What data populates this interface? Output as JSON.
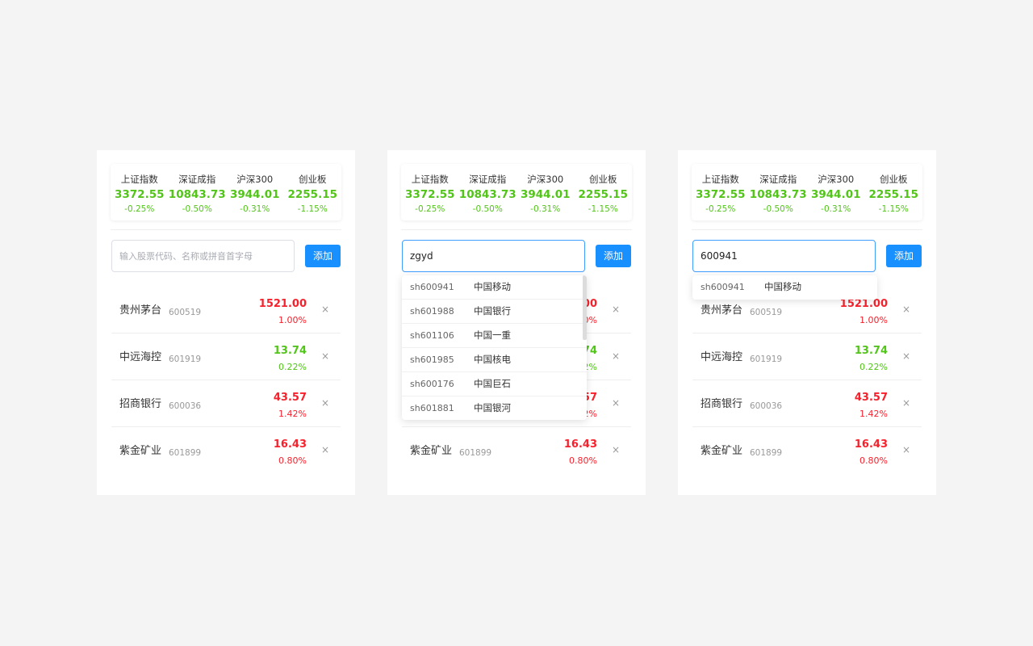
{
  "indices": [
    {
      "name": "上证指数",
      "value": "3372.55",
      "change": "-0.25%"
    },
    {
      "name": "深证成指",
      "value": "10843.73",
      "change": "-0.50%"
    },
    {
      "name": "沪深300",
      "value": "3944.01",
      "change": "-0.31%"
    },
    {
      "name": "创业板",
      "value": "2255.15",
      "change": "-1.15%"
    }
  ],
  "colors": {
    "rise": "#f5222d",
    "fall": "#52c41a",
    "primary": "#1890ff"
  },
  "add_label": "添加",
  "stocks": [
    {
      "name": "贵州茅台",
      "code": "600519",
      "price": "1521.00",
      "pct": "1.00%",
      "trend": "up"
    },
    {
      "name": "中远海控",
      "code": "601919",
      "price": "13.74",
      "pct": "0.22%",
      "trend": "down"
    },
    {
      "name": "招商银行",
      "code": "600036",
      "price": "43.57",
      "pct": "1.42%",
      "trend": "up"
    },
    {
      "name": "紫金矿业",
      "code": "601899",
      "price": "16.43",
      "pct": "0.80%",
      "trend": "up"
    }
  ],
  "remove_icon": "×",
  "panels": [
    {
      "search_value": "",
      "search_placeholder": "输入股票代码、名称或拼音首字母",
      "suggestions": []
    },
    {
      "search_value": "zgyd",
      "search_placeholder": "输入股票代码、名称或拼音首字母",
      "suggestions": [
        {
          "code": "sh600941",
          "name": "中国移动"
        },
        {
          "code": "sh601988",
          "name": "中国银行"
        },
        {
          "code": "sh601106",
          "name": "中国一重"
        },
        {
          "code": "sh601985",
          "name": "中国核电"
        },
        {
          "code": "sh600176",
          "name": "中国巨石"
        },
        {
          "code": "sh601881",
          "name": "中国银河"
        }
      ]
    },
    {
      "search_value": "600941",
      "search_placeholder": "输入股票代码、名称或拼音首字母",
      "suggestions": [
        {
          "code": "sh600941",
          "name": "中国移动"
        }
      ]
    }
  ]
}
